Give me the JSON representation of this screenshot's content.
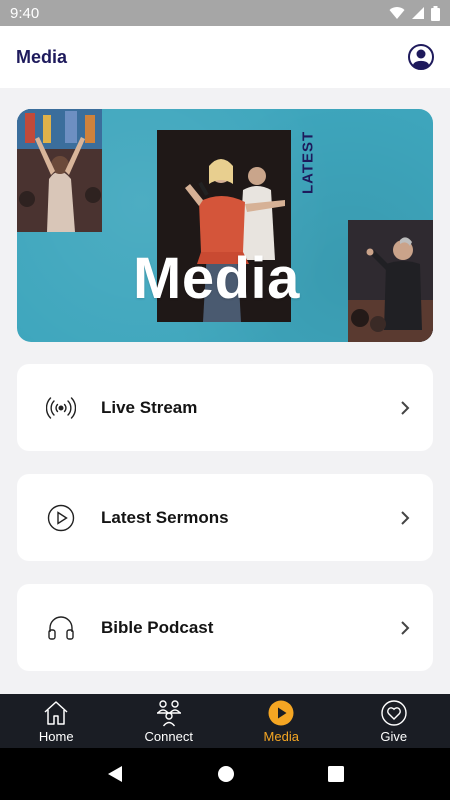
{
  "status_bar": {
    "time": "9:40"
  },
  "header": {
    "title": "Media"
  },
  "hero": {
    "latest_label": "LATEST",
    "word": "Media"
  },
  "menu": {
    "items": [
      {
        "label": "Live Stream",
        "icon": "broadcast-icon"
      },
      {
        "label": "Latest Sermons",
        "icon": "play-circle-icon"
      },
      {
        "label": "Bible Podcast",
        "icon": "headphones-icon"
      }
    ]
  },
  "bottom_nav": {
    "items": [
      {
        "label": "Home",
        "icon": "home-icon"
      },
      {
        "label": "Connect",
        "icon": "people-icon"
      },
      {
        "label": "Media",
        "icon": "play-circle-icon",
        "active": true
      },
      {
        "label": "Give",
        "icon": "heart-circle-icon"
      }
    ],
    "active_color": "#f5a623"
  },
  "colors": {
    "brand": "#1e1a5c",
    "hero_bg": "#3ea6bd",
    "nav_bg": "#1a1d24"
  }
}
